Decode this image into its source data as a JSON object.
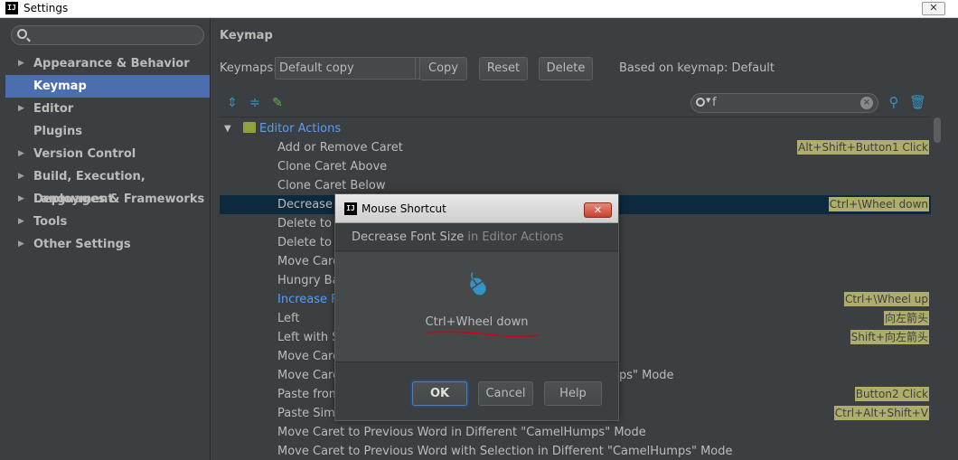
{
  "window": {
    "title": "Settings",
    "logo": "IJ",
    "close_glyph": "✕"
  },
  "sidebar": {
    "search_placeholder": "",
    "items": [
      {
        "label": "Appearance & Behavior",
        "expandable": true,
        "selected": false
      },
      {
        "label": "Keymap",
        "expandable": false,
        "selected": true
      },
      {
        "label": "Editor",
        "expandable": true,
        "selected": false
      },
      {
        "label": "Plugins",
        "expandable": false,
        "selected": false
      },
      {
        "label": "Version Control",
        "expandable": true,
        "selected": false
      },
      {
        "label": "Build, Execution, Deployment",
        "expandable": true,
        "selected": false
      },
      {
        "label": "Languages & Frameworks",
        "expandable": true,
        "selected": false
      },
      {
        "label": "Tools",
        "expandable": true,
        "selected": false
      },
      {
        "label": "Other Settings",
        "expandable": true,
        "selected": false
      }
    ]
  },
  "main": {
    "title": "Keymap",
    "keymaps_label": "Keymaps:",
    "keymap_value": "Default copy",
    "copy_label": "Copy",
    "reset_label": "Reset",
    "delete_label": "Delete",
    "based_on": "Based on keymap: Default",
    "filter_value": "f"
  },
  "tree": {
    "group_label": "Editor Actions",
    "rows": [
      {
        "name": "Add or Remove Caret",
        "shortcut": "Alt+Shift+Button1 Click"
      },
      {
        "name": "Clone Caret Above",
        "shortcut": ""
      },
      {
        "name": "Clone Caret Below",
        "shortcut": ""
      },
      {
        "name": "Decrease F",
        "shortcut": "Ctrl+\\Wheel down",
        "selected": true
      },
      {
        "name": "Delete to W",
        "shortcut": ""
      },
      {
        "name": "Delete to W",
        "shortcut": ""
      },
      {
        "name": "Move Care",
        "shortcut": ""
      },
      {
        "name": "Hungry Bac",
        "shortcut": ""
      },
      {
        "name": "Increase F",
        "shortcut": "Ctrl+\\Wheel up",
        "link": true
      },
      {
        "name": "Left",
        "shortcut": "向左箭头"
      },
      {
        "name": "Left with Se",
        "shortcut": "Shift+向左箭头"
      },
      {
        "name": "Move Care",
        "shortcut": ""
      },
      {
        "name": "Move Care",
        "tail": "ps\" Mode",
        "shortcut": ""
      },
      {
        "name": "Paste from",
        "shortcut": "Button2 Click"
      },
      {
        "name": "Paste Simp",
        "shortcut": "Ctrl+Alt+Shift+V"
      },
      {
        "name": "Move Caret to Previous Word in Different \"CamelHumps\" Mode",
        "shortcut": ""
      },
      {
        "name": "Move Caret to Previous Word with Selection in Different \"CamelHumps\" Mode",
        "shortcut": ""
      }
    ]
  },
  "dialog": {
    "title": "Mouse Shortcut",
    "logo": "IJ",
    "close_glyph": "✕",
    "action_name": "Decrease Font Size",
    "action_context": " in Editor Actions",
    "shortcut": "Ctrl+Wheel down",
    "ok_label": "OK",
    "cancel_label": "Cancel",
    "help_label": "Help"
  },
  "colors": {
    "background": "#3c3f41",
    "selection": "#4b6eaf",
    "row_selection": "#0d293e",
    "link": "#589df6",
    "shortcut_badge": "#aeae6a",
    "match_highlight": "#cfa92f",
    "annotation": "#d0021b"
  },
  "icons": [
    "search-icon",
    "expand-all-icon",
    "collapse-all-icon",
    "edit-icon",
    "find-shortcut-icon",
    "trash-icon",
    "mouse-icon",
    "folder-icon"
  ]
}
